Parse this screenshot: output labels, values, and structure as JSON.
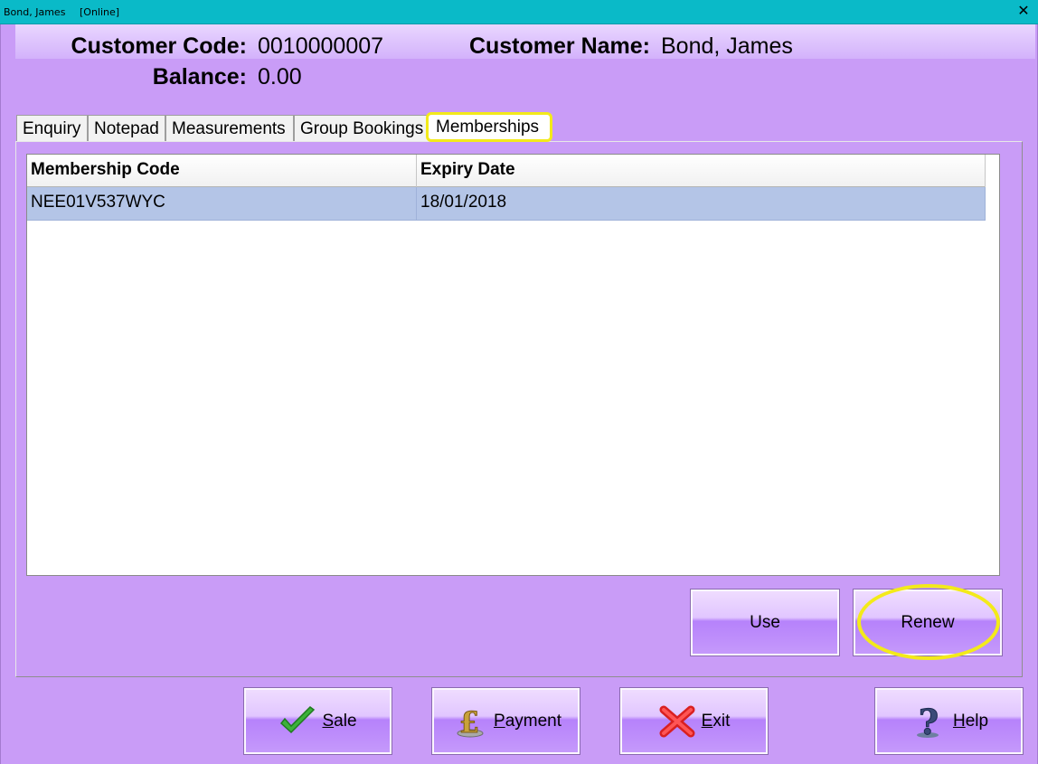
{
  "titlebar": {
    "name": "Bond, James",
    "status": "[Online]",
    "close_glyph": "✕"
  },
  "header": {
    "customer_code_label": "Customer Code:",
    "customer_code": "0010000007",
    "customer_name_label": "Customer Name:",
    "customer_name": "Bond, James",
    "balance_label": "Balance:",
    "balance": "0.00"
  },
  "tabs": [
    {
      "label": "Enquiry"
    },
    {
      "label": "Notepad"
    },
    {
      "label": "Measurements"
    },
    {
      "label": "Group Bookings"
    },
    {
      "label": "Memberships",
      "active": true
    }
  ],
  "grid": {
    "columns": [
      "Membership Code",
      "Expiry Date"
    ],
    "rows": [
      {
        "code": "NEE01V537WYC",
        "expiry": "18/01/2018",
        "selected": true
      }
    ]
  },
  "panel_buttons": {
    "use": "Use",
    "renew": "Renew"
  },
  "footer_buttons": {
    "sale_first": "S",
    "sale_rest": "ale",
    "payment_first": "P",
    "payment_rest": "ayment",
    "exit_first": "E",
    "exit_rest": "xit",
    "help_first": "H",
    "help_rest": "elp"
  },
  "colors": {
    "accent_highlight": "#f3ea1a",
    "selected_row": "#b4c5e7",
    "titlebar": "#0abac8",
    "window_bg": "#c99cf7"
  }
}
